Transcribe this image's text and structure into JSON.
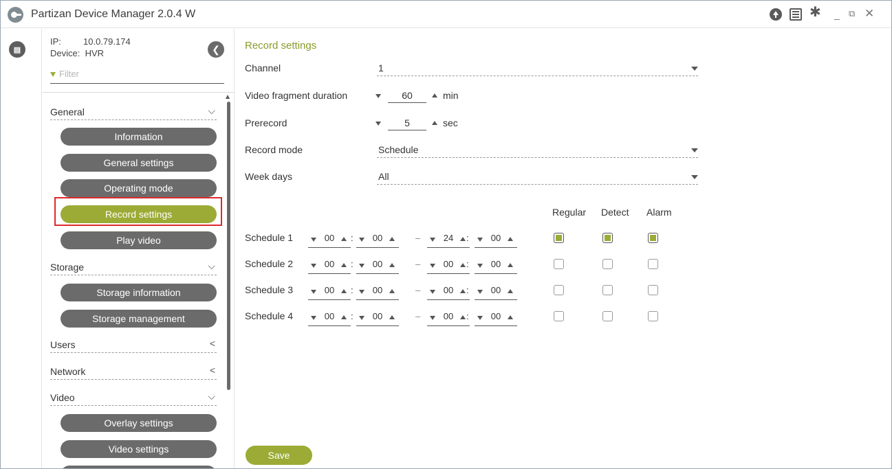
{
  "app": {
    "title": "Partizan Device Manager 2.0.4 W"
  },
  "titlebar": {
    "icons": [
      "upload-icon",
      "list-icon",
      "gear-icon"
    ],
    "minimize": "_",
    "restore": "⧉",
    "close": "✕"
  },
  "device": {
    "ip_label": "IP:",
    "ip": "10.0.79.174",
    "device_label": "Device:",
    "device": "HVR"
  },
  "filter": {
    "placeholder": "Filter"
  },
  "nav": {
    "general": {
      "label": "General",
      "items": [
        "Information",
        "General settings",
        "Operating mode",
        "Record settings",
        "Play video"
      ]
    },
    "storage": {
      "label": "Storage",
      "items": [
        "Storage information",
        "Storage management"
      ]
    },
    "users": {
      "label": "Users"
    },
    "network": {
      "label": "Network"
    },
    "video": {
      "label": "Video",
      "items": [
        "Overlay settings",
        "Video settings"
      ]
    },
    "active_item": "Record settings"
  },
  "main": {
    "title": "Record settings",
    "channel": {
      "label": "Channel",
      "value": "1"
    },
    "fragment": {
      "label": "Video fragment duration",
      "value": "60",
      "unit": "min"
    },
    "prerecord": {
      "label": "Prerecord",
      "value": "5",
      "unit": "sec"
    },
    "record_mode": {
      "label": "Record mode",
      "value": "Schedule"
    },
    "week_days": {
      "label": "Week days",
      "value": "All"
    },
    "columns": [
      "Regular",
      "Detect",
      "Alarm"
    ],
    "schedules": [
      {
        "label": "Schedule 1",
        "start_h": "00",
        "start_m": "00",
        "end_h": "24",
        "end_m": "00",
        "regular": true,
        "detect": true,
        "alarm": true
      },
      {
        "label": "Schedule 2",
        "start_h": "00",
        "start_m": "00",
        "end_h": "00",
        "end_m": "00",
        "regular": false,
        "detect": false,
        "alarm": false
      },
      {
        "label": "Schedule 3",
        "start_h": "00",
        "start_m": "00",
        "end_h": "00",
        "end_m": "00",
        "regular": false,
        "detect": false,
        "alarm": false
      },
      {
        "label": "Schedule 4",
        "start_h": "00",
        "start_m": "00",
        "end_h": "00",
        "end_m": "00",
        "regular": false,
        "detect": false,
        "alarm": false
      }
    ],
    "save_label": "Save"
  },
  "colors": {
    "accent": "#9bab35",
    "pill": "#6b6b6b",
    "highlight": "#e0282a"
  }
}
